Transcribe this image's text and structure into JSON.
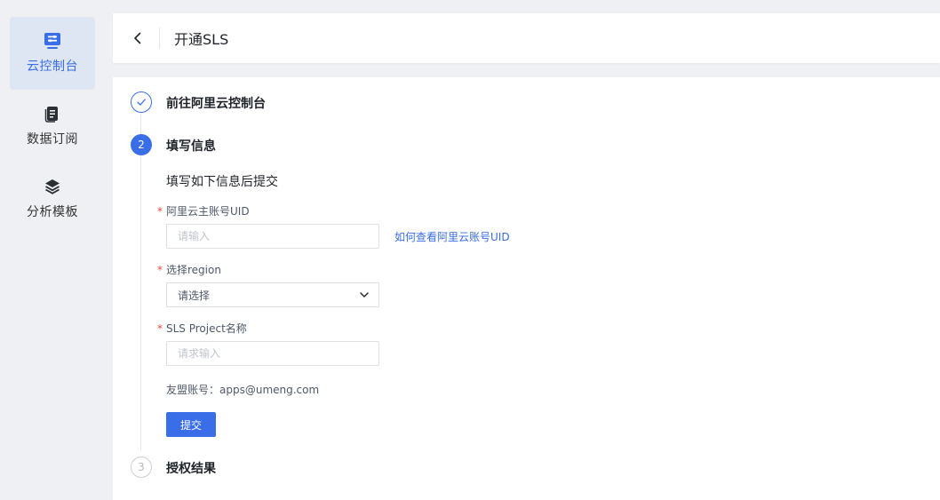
{
  "sidebar": {
    "items": [
      {
        "label": "云控制台",
        "icon": "console-icon",
        "active": true
      },
      {
        "label": "数据订阅",
        "icon": "document-icon",
        "active": false
      },
      {
        "label": "分析模板",
        "icon": "layers-icon",
        "active": false
      }
    ]
  },
  "header": {
    "title": "开通SLS",
    "back_icon": "chevron-left-icon"
  },
  "steps": [
    {
      "title": "前往阿里云控制台",
      "state": "done",
      "marker": ""
    },
    {
      "title": "填写信息",
      "state": "current",
      "marker": "2"
    },
    {
      "title": "授权结果",
      "state": "pending",
      "marker": "3"
    }
  ],
  "form": {
    "title": "填写如下信息后提交",
    "uid": {
      "label": "阿里云主账号UID",
      "placeholder": "请输入",
      "value": ""
    },
    "help_link": "如何查看阿里云账号UID",
    "region": {
      "label": "选择region",
      "placeholder": "请选择"
    },
    "project": {
      "label": "SLS Project名称",
      "placeholder": "请求输入",
      "value": ""
    },
    "account_text": "友盟账号：apps@umeng.com",
    "submit_label": "提交",
    "required_mark": "*"
  },
  "colors": {
    "accent": "#3a6ee8",
    "required": "#e84a3a",
    "sidebar_active_bg": "#dfe6f3"
  }
}
